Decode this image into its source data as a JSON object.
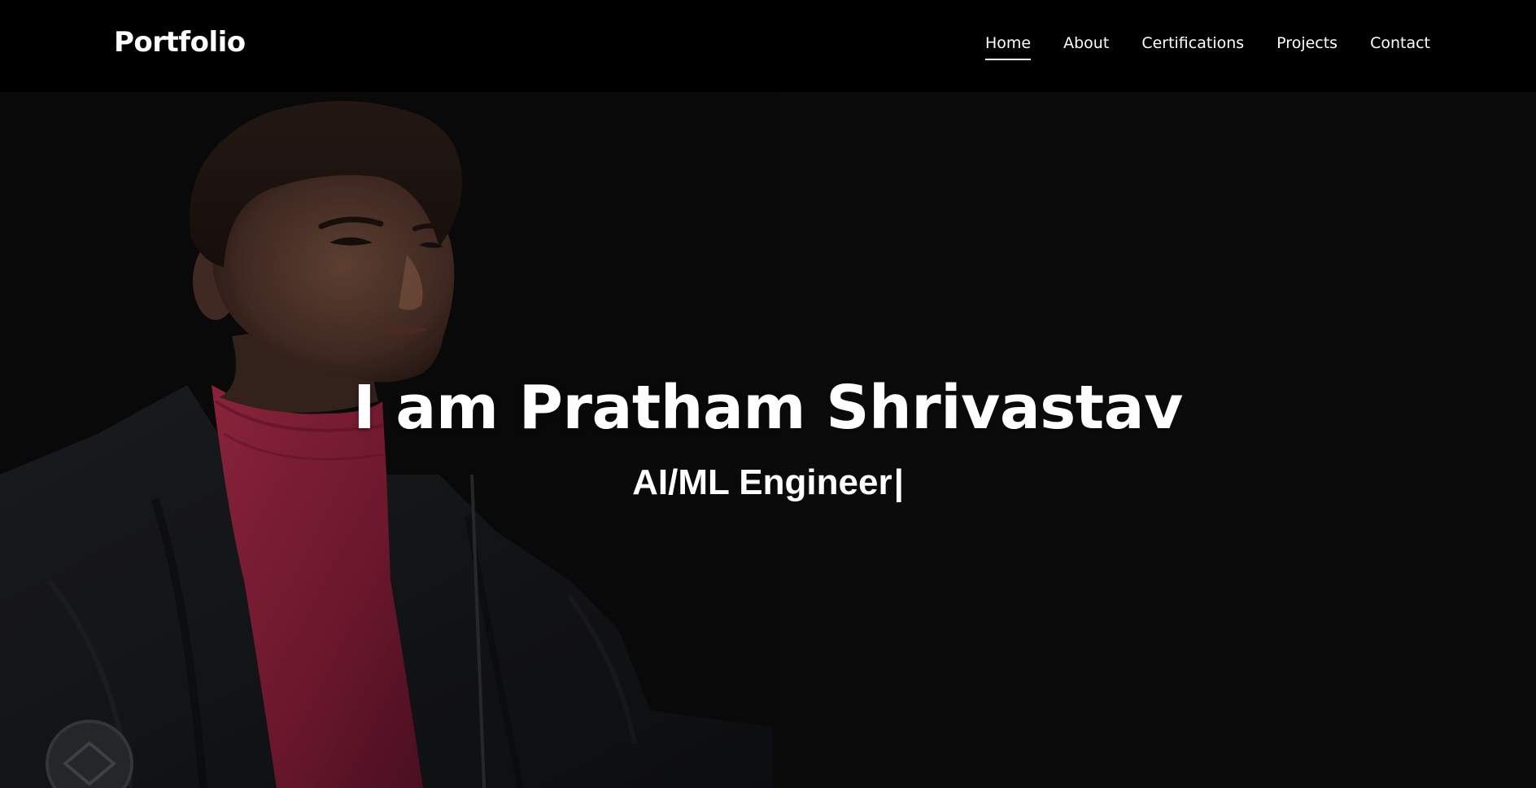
{
  "header": {
    "brand": "Portfolio",
    "nav": [
      {
        "label": "Home",
        "active": true
      },
      {
        "label": "About",
        "active": false
      },
      {
        "label": "Certifications",
        "active": false
      },
      {
        "label": "Projects",
        "active": false
      },
      {
        "label": "Contact",
        "active": false
      }
    ]
  },
  "hero": {
    "title": "I am Pratham Shrivastav",
    "subtitle": "AI/ML Engineer",
    "cursor": "|"
  },
  "colors": {
    "background": "#0b0b0b",
    "navbar": "#000000",
    "text": "#ffffff",
    "sweater": "#8e1f3a",
    "jacket": "#141518"
  }
}
